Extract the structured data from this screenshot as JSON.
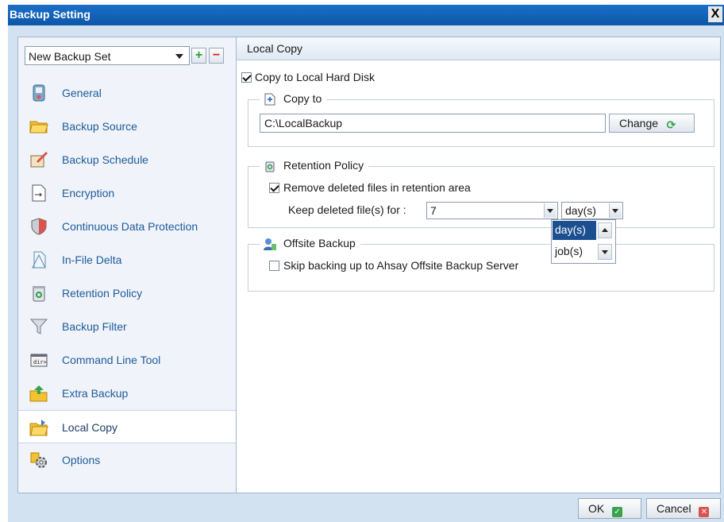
{
  "window": {
    "title": "Backup Setting",
    "close_glyph": "X"
  },
  "sidebar": {
    "backup_set": {
      "selected": "New Backup Set",
      "add_label": "+",
      "remove_label": "−"
    },
    "items": [
      {
        "label": "General",
        "icon": "general-icon"
      },
      {
        "label": "Backup Source",
        "icon": "folder-icon"
      },
      {
        "label": "Backup Schedule",
        "icon": "schedule-icon"
      },
      {
        "label": "Encryption",
        "icon": "encryption-icon"
      },
      {
        "label": "Continuous Data Protection",
        "icon": "shield-icon"
      },
      {
        "label": "In-File Delta",
        "icon": "document-icon"
      },
      {
        "label": "Retention Policy",
        "icon": "recycle-bin-icon"
      },
      {
        "label": "Backup Filter",
        "icon": "filter-icon"
      },
      {
        "label": "Command Line Tool",
        "icon": "terminal-icon"
      },
      {
        "label": "Extra Backup",
        "icon": "extra-backup-icon"
      },
      {
        "label": "Local Copy",
        "icon": "local-copy-icon",
        "selected": true
      },
      {
        "label": "Options",
        "icon": "options-gear-icon"
      }
    ]
  },
  "main": {
    "header": "Local Copy",
    "copy_to_local": {
      "label": "Copy to Local Hard Disk",
      "checked": true
    },
    "copy_to": {
      "legend": "Copy to",
      "path": "C:\\LocalBackup",
      "change_label": "Change"
    },
    "retention": {
      "legend": "Retention Policy",
      "remove_label": "Remove deleted files in retention area",
      "remove_checked": true,
      "keep_label": "Keep deleted file(s) for :",
      "keep_value": "7",
      "unit_selected": "day(s)",
      "unit_options": [
        "day(s)",
        "job(s)"
      ]
    },
    "offsite": {
      "legend": "Offsite Backup",
      "skip_label": "Skip backing up to Ahsay Offsite Backup Server",
      "skip_checked": false
    }
  },
  "footer": {
    "ok_label": "OK",
    "cancel_label": "Cancel"
  },
  "colors": {
    "title_bar": "#0d56a8",
    "dialog_bg": "#d3e2f0",
    "nav_text": "#1e5a99",
    "dropdown_highlight": "#1b4f8f"
  }
}
